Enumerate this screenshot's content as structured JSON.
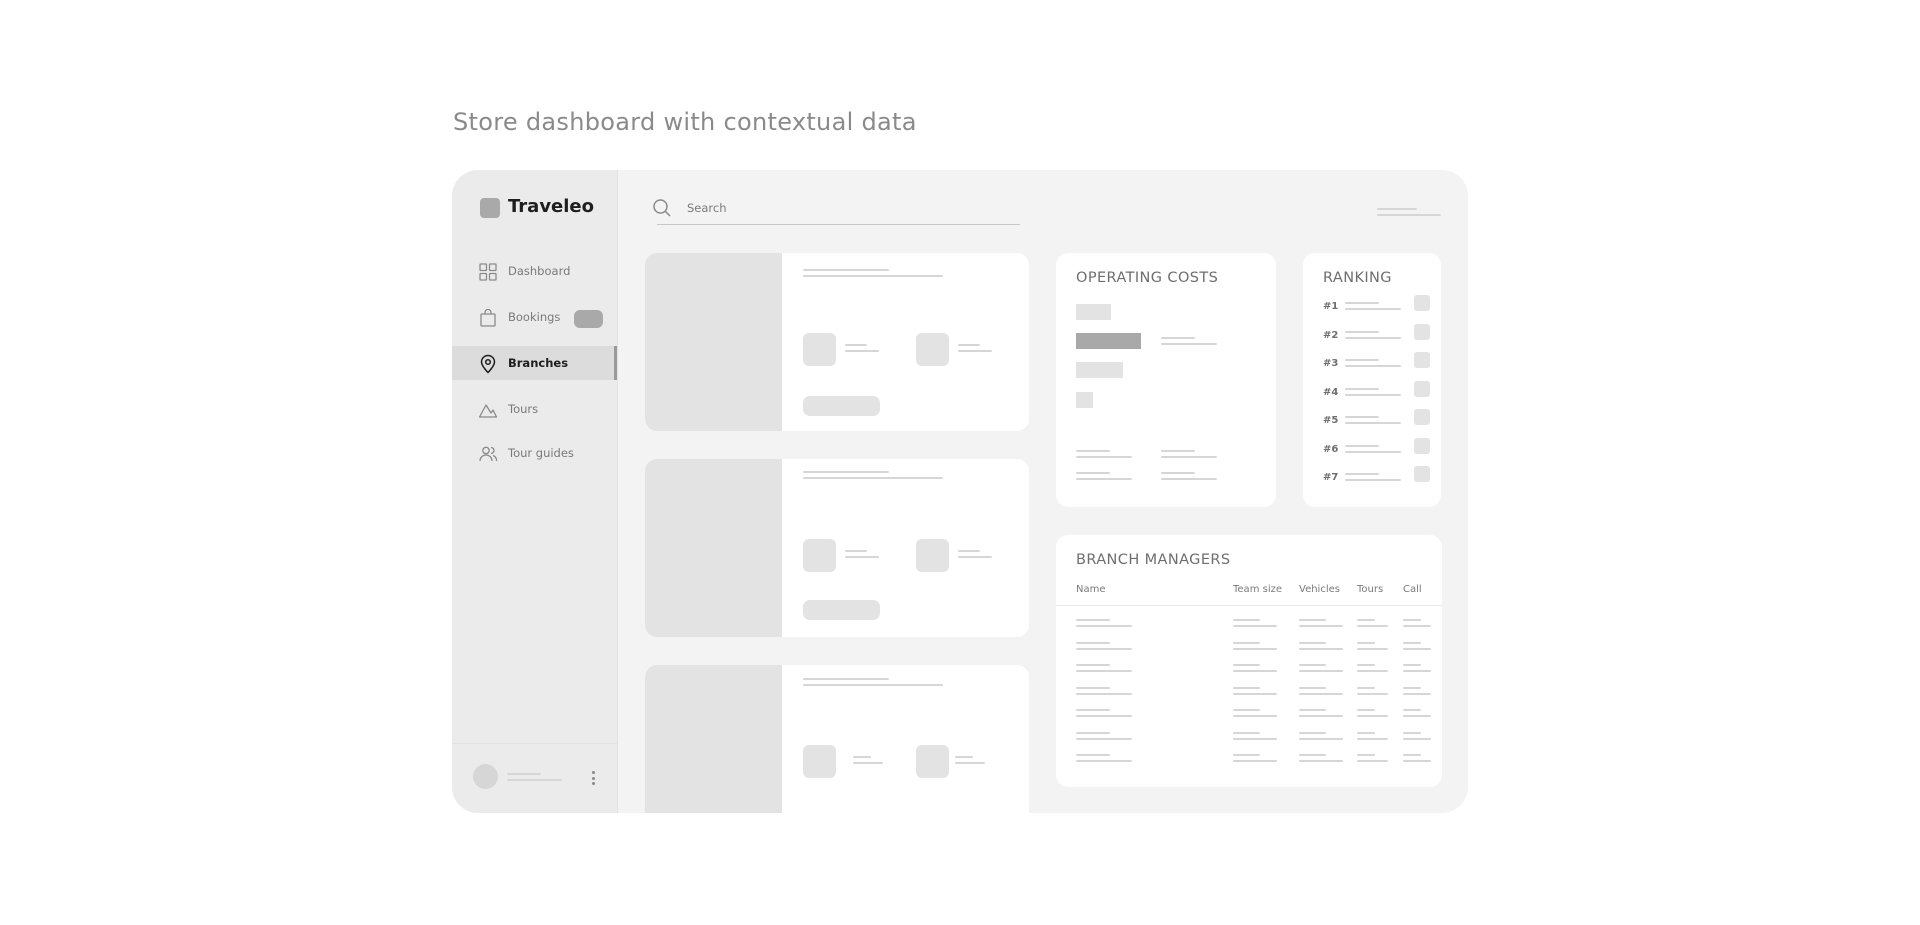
{
  "heading": "Store dashboard with contextual data",
  "app": {
    "name": "Traveleo"
  },
  "sidebar": {
    "items": [
      {
        "label": "Dashboard",
        "icon": "dashboard-grid-icon"
      },
      {
        "label": "Bookings",
        "icon": "shopping-bag-icon"
      },
      {
        "label": "Branches",
        "icon": "map-pin-icon",
        "active": true
      },
      {
        "label": "Tours",
        "icon": "mountain-icon"
      },
      {
        "label": "Tour guides",
        "icon": "users-icon"
      }
    ]
  },
  "search": {
    "placeholder": "Search",
    "icon": "search-icon"
  },
  "operating_costs": {
    "title": "OPERATING COSTS"
  },
  "ranking": {
    "title": "RANKING",
    "ranks": [
      "#1",
      "#2",
      "#3",
      "#4",
      "#5",
      "#6",
      "#7"
    ]
  },
  "branch_managers": {
    "title": "BRANCH MANAGERS",
    "columns": {
      "name": "Name",
      "team_size": "Team size",
      "vehicles": "Vehicles",
      "tours": "Tours",
      "call": "Call"
    }
  },
  "colors": {
    "frame_bg": "#f3f3f3",
    "sidebar_bg": "#ebebeb",
    "card_bg": "#ffffff",
    "placeholder": "#e3e3e3",
    "accent_grey": "#a9a9a9"
  }
}
